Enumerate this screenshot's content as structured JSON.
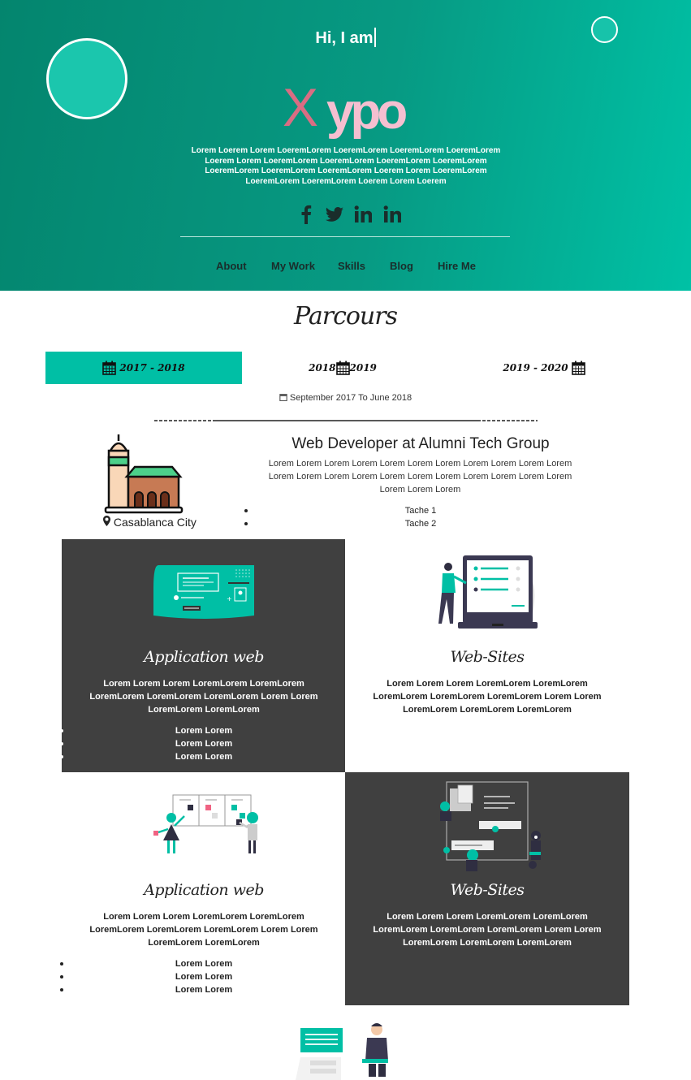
{
  "hero": {
    "greeting": "Hi, I am",
    "logo_first": "X",
    "logo_rest": "ypo",
    "description": "Lorem Loerem Lorem LoeremLorem LoeremLorem LoeremLorem LoeremLorem Loerem Lorem LoeremLorem LoeremLorem LoeremLorem LoeremLorem LoeremLorem LoeremLorem LoeremLorem Loerem Lorem LoeremLorem LoeremLorem LoeremLorem Loerem Lorem Loerem",
    "socials": [
      "facebook-icon",
      "twitter-icon",
      "linkedin-icon",
      "linkedin-icon"
    ],
    "colors": {
      "gradient_start": "#04856e",
      "gradient_end": "#00c1a5",
      "logo_x": "#d96d83",
      "logo_rest": "#f5bfd0"
    }
  },
  "nav": {
    "about": "About",
    "work": "My Work",
    "skills": "Skills",
    "blog": "Blog",
    "hire": "Hire Me"
  },
  "parcours": {
    "title": "Parcours",
    "tabs": [
      {
        "label": "2017 - 2018",
        "active": true
      },
      {
        "label_a": "2018",
        "label_b": "2019",
        "active": false
      },
      {
        "label": "2019 - 2020",
        "active": false
      }
    ],
    "date_range": "September 2017 To June 2018",
    "city": "Casablanca City",
    "job_title": "Web Developer at Alumni Tech Group",
    "job_description": "Lorem Lorem Lorem Lorem Lorem Lorem Lorem Lorem Lorem Lorem Lorem Lorem Lorem Lorem Lorem Lorem Lorem Lorem Lorem Lorem Lorem Lorem Lorem Lorem Lorem",
    "tasks": [
      "Tache 1",
      "Tache 2"
    ],
    "accent": "#00bfa5"
  },
  "cards": [
    {
      "title": "Application web",
      "description": "Lorem Lorem Lorem LoremLorem LoremLorem LoremLorem LoremLorem LoremLorem Lorem Lorem LoremLorem LoremLorem",
      "items": [
        "Lorem Lorem",
        "Lorem Lorem",
        "Lorem Lorem"
      ]
    },
    {
      "title": "Web-Sites",
      "description": "Lorem Lorem Lorem LoremLorem LoremLorem LoremLorem LoremLorem LoremLorem Lorem Lorem LoremLorem LoremLorem LoremLorem"
    },
    {
      "title": "Application web",
      "description": "Lorem Lorem Lorem LoremLorem LoremLorem LoremLorem LoremLorem LoremLorem Lorem Lorem LoremLorem LoremLorem",
      "items": [
        "Lorem Lorem",
        "Lorem Lorem",
        "Lorem Lorem"
      ]
    },
    {
      "title": "Web-Sites",
      "description": "Lorem Lorem Lorem LoremLorem LoremLorem LoremLorem LoremLorem LoremLorem Lorem Lorem LoremLorem LoremLorem LoremLorem"
    }
  ]
}
